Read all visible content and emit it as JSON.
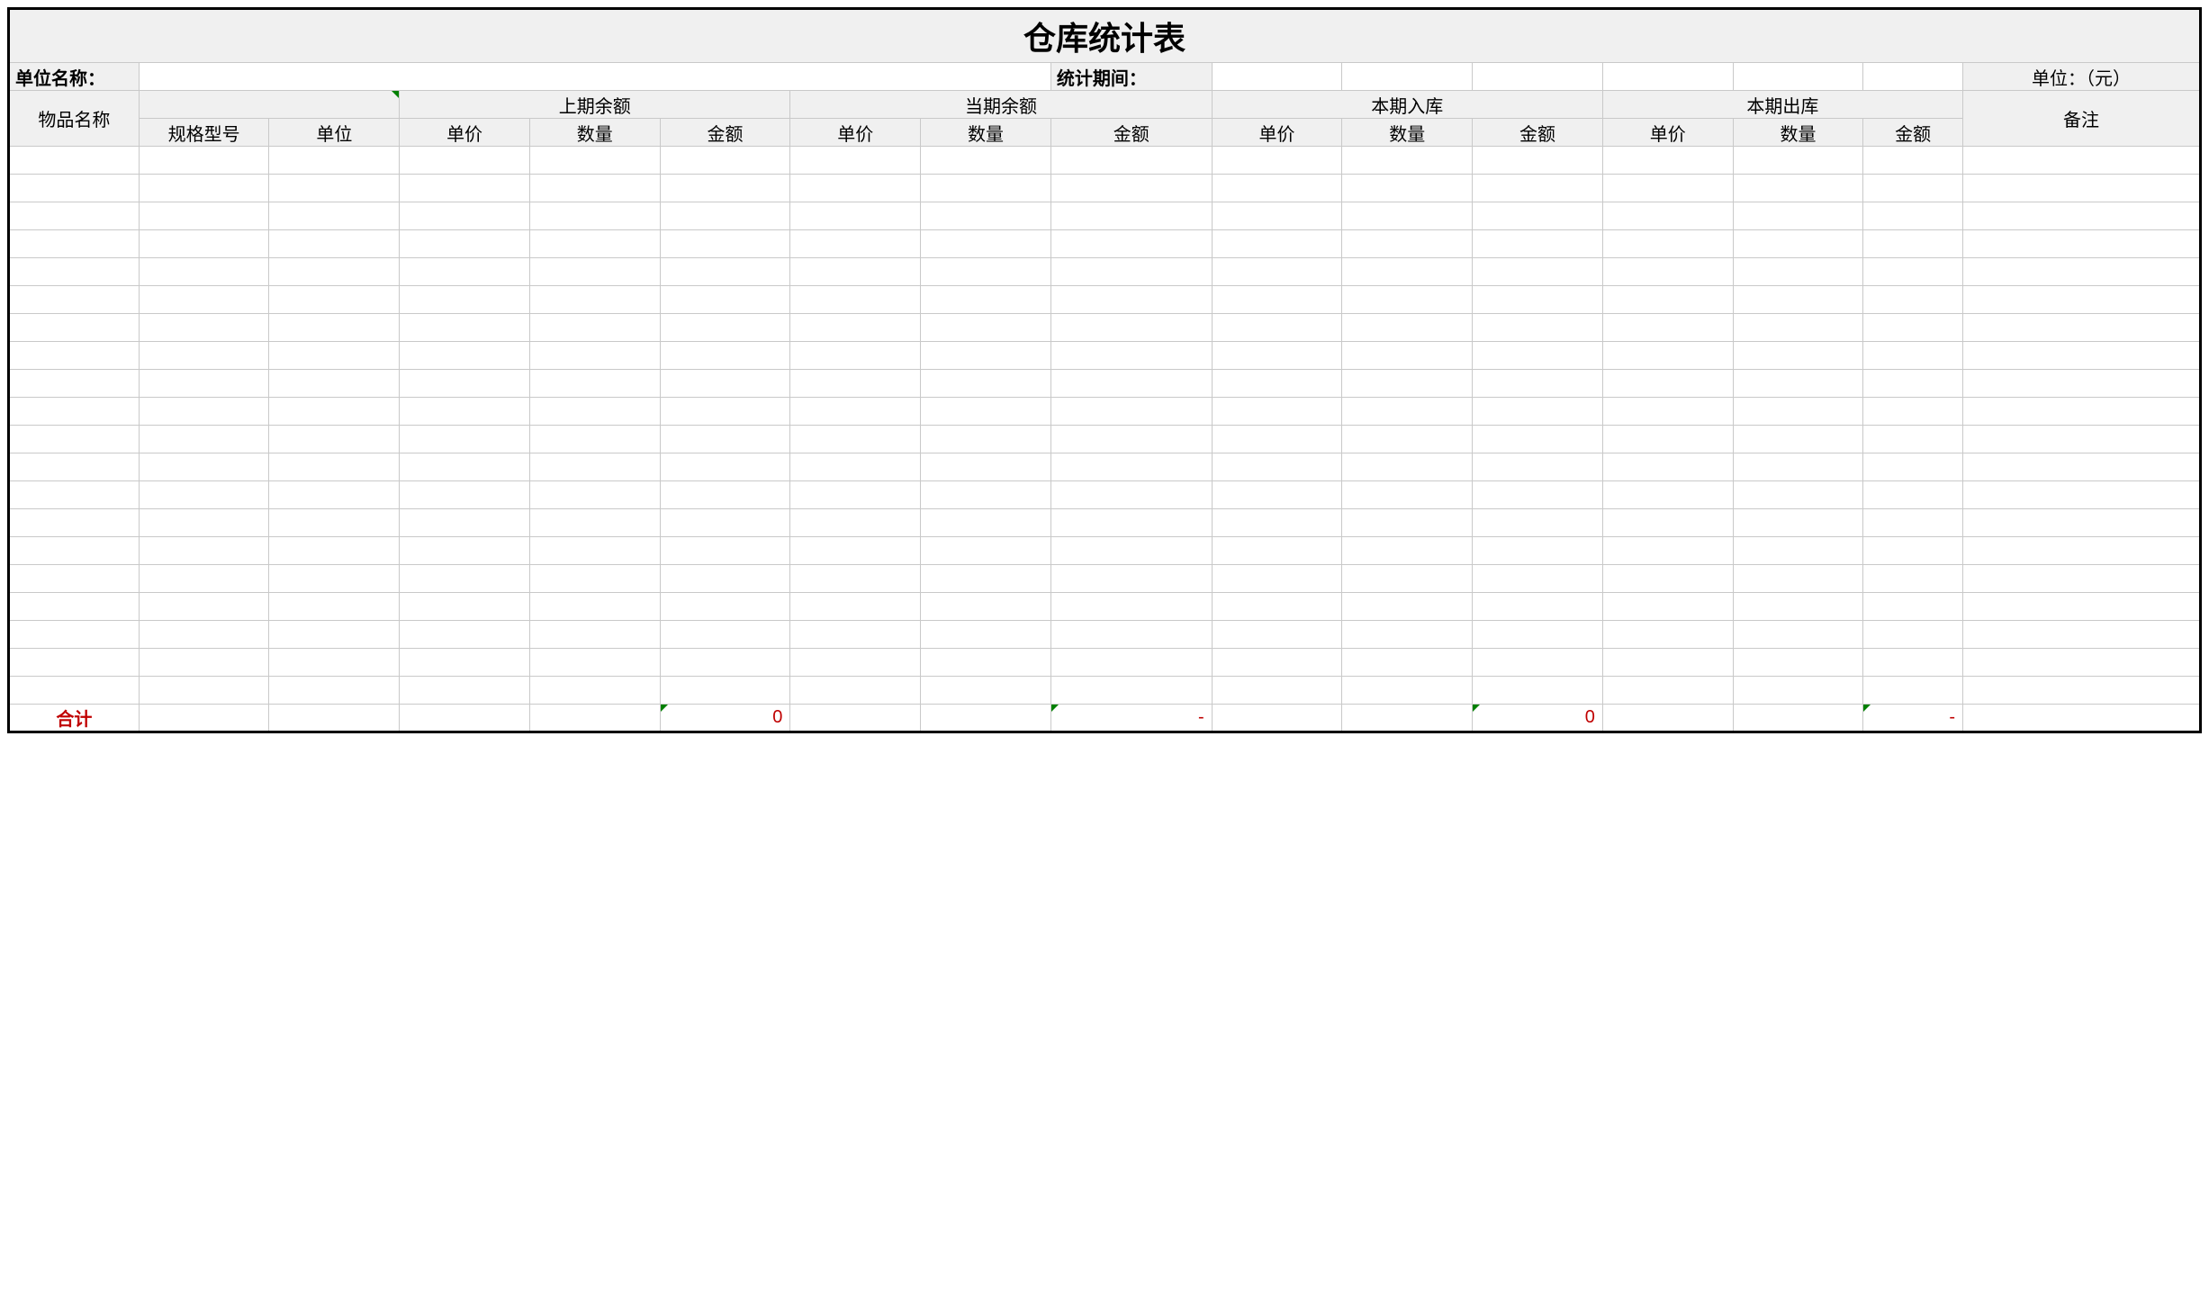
{
  "title": "仓库统计表",
  "meta": {
    "org_label": "单位名称：",
    "org_value": "",
    "period_label": "统计期间：",
    "period_value": "",
    "unit_label": "单位：（元）"
  },
  "headers": {
    "item_name": "物品名称",
    "spec": "规格型号",
    "unit": "单位",
    "group_prev": "上期余额",
    "group_curr": "当期余额",
    "group_in": "本期入库",
    "group_out": "本期出库",
    "price": "单价",
    "qty": "数量",
    "amount": "金额",
    "remark": "备注"
  },
  "data_row_count": 20,
  "totals": {
    "label": "合计",
    "prev_qty": "",
    "prev_amount": "0",
    "curr_qty": "",
    "curr_amount": "-",
    "in_qty": "",
    "in_amount": "0",
    "out_qty": "",
    "out_amount": "-"
  }
}
